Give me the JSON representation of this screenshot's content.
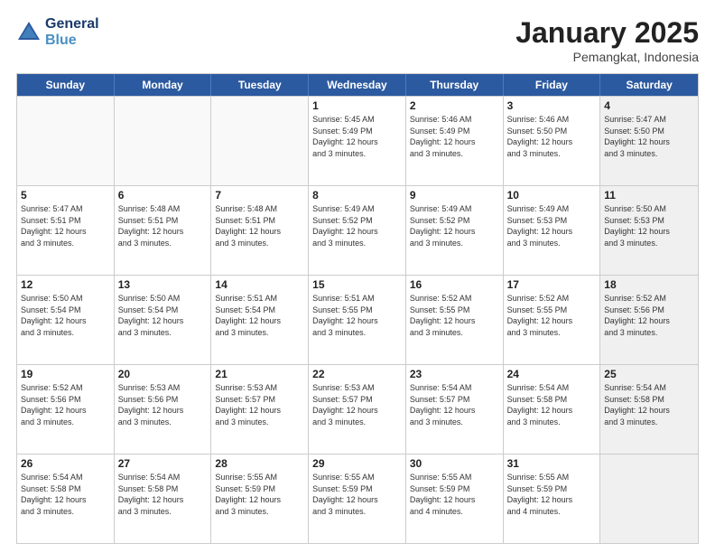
{
  "logo": {
    "line1": "General",
    "line2": "Blue"
  },
  "header": {
    "month": "January 2025",
    "location": "Pemangkat, Indonesia"
  },
  "weekdays": [
    "Sunday",
    "Monday",
    "Tuesday",
    "Wednesday",
    "Thursday",
    "Friday",
    "Saturday"
  ],
  "rows": [
    [
      {
        "day": "",
        "text": "",
        "empty": true
      },
      {
        "day": "",
        "text": "",
        "empty": true
      },
      {
        "day": "",
        "text": "",
        "empty": true
      },
      {
        "day": "1",
        "text": "Sunrise: 5:45 AM\nSunset: 5:49 PM\nDaylight: 12 hours\nand 3 minutes."
      },
      {
        "day": "2",
        "text": "Sunrise: 5:46 AM\nSunset: 5:49 PM\nDaylight: 12 hours\nand 3 minutes."
      },
      {
        "day": "3",
        "text": "Sunrise: 5:46 AM\nSunset: 5:50 PM\nDaylight: 12 hours\nand 3 minutes."
      },
      {
        "day": "4",
        "text": "Sunrise: 5:47 AM\nSunset: 5:50 PM\nDaylight: 12 hours\nand 3 minutes.",
        "shaded": true
      }
    ],
    [
      {
        "day": "5",
        "text": "Sunrise: 5:47 AM\nSunset: 5:51 PM\nDaylight: 12 hours\nand 3 minutes."
      },
      {
        "day": "6",
        "text": "Sunrise: 5:48 AM\nSunset: 5:51 PM\nDaylight: 12 hours\nand 3 minutes."
      },
      {
        "day": "7",
        "text": "Sunrise: 5:48 AM\nSunset: 5:51 PM\nDaylight: 12 hours\nand 3 minutes."
      },
      {
        "day": "8",
        "text": "Sunrise: 5:49 AM\nSunset: 5:52 PM\nDaylight: 12 hours\nand 3 minutes."
      },
      {
        "day": "9",
        "text": "Sunrise: 5:49 AM\nSunset: 5:52 PM\nDaylight: 12 hours\nand 3 minutes."
      },
      {
        "day": "10",
        "text": "Sunrise: 5:49 AM\nSunset: 5:53 PM\nDaylight: 12 hours\nand 3 minutes."
      },
      {
        "day": "11",
        "text": "Sunrise: 5:50 AM\nSunset: 5:53 PM\nDaylight: 12 hours\nand 3 minutes.",
        "shaded": true
      }
    ],
    [
      {
        "day": "12",
        "text": "Sunrise: 5:50 AM\nSunset: 5:54 PM\nDaylight: 12 hours\nand 3 minutes."
      },
      {
        "day": "13",
        "text": "Sunrise: 5:50 AM\nSunset: 5:54 PM\nDaylight: 12 hours\nand 3 minutes."
      },
      {
        "day": "14",
        "text": "Sunrise: 5:51 AM\nSunset: 5:54 PM\nDaylight: 12 hours\nand 3 minutes."
      },
      {
        "day": "15",
        "text": "Sunrise: 5:51 AM\nSunset: 5:55 PM\nDaylight: 12 hours\nand 3 minutes."
      },
      {
        "day": "16",
        "text": "Sunrise: 5:52 AM\nSunset: 5:55 PM\nDaylight: 12 hours\nand 3 minutes."
      },
      {
        "day": "17",
        "text": "Sunrise: 5:52 AM\nSunset: 5:55 PM\nDaylight: 12 hours\nand 3 minutes."
      },
      {
        "day": "18",
        "text": "Sunrise: 5:52 AM\nSunset: 5:56 PM\nDaylight: 12 hours\nand 3 minutes.",
        "shaded": true
      }
    ],
    [
      {
        "day": "19",
        "text": "Sunrise: 5:52 AM\nSunset: 5:56 PM\nDaylight: 12 hours\nand 3 minutes."
      },
      {
        "day": "20",
        "text": "Sunrise: 5:53 AM\nSunset: 5:56 PM\nDaylight: 12 hours\nand 3 minutes."
      },
      {
        "day": "21",
        "text": "Sunrise: 5:53 AM\nSunset: 5:57 PM\nDaylight: 12 hours\nand 3 minutes."
      },
      {
        "day": "22",
        "text": "Sunrise: 5:53 AM\nSunset: 5:57 PM\nDaylight: 12 hours\nand 3 minutes."
      },
      {
        "day": "23",
        "text": "Sunrise: 5:54 AM\nSunset: 5:57 PM\nDaylight: 12 hours\nand 3 minutes."
      },
      {
        "day": "24",
        "text": "Sunrise: 5:54 AM\nSunset: 5:58 PM\nDaylight: 12 hours\nand 3 minutes."
      },
      {
        "day": "25",
        "text": "Sunrise: 5:54 AM\nSunset: 5:58 PM\nDaylight: 12 hours\nand 3 minutes.",
        "shaded": true
      }
    ],
    [
      {
        "day": "26",
        "text": "Sunrise: 5:54 AM\nSunset: 5:58 PM\nDaylight: 12 hours\nand 3 minutes."
      },
      {
        "day": "27",
        "text": "Sunrise: 5:54 AM\nSunset: 5:58 PM\nDaylight: 12 hours\nand 3 minutes."
      },
      {
        "day": "28",
        "text": "Sunrise: 5:55 AM\nSunset: 5:59 PM\nDaylight: 12 hours\nand 3 minutes."
      },
      {
        "day": "29",
        "text": "Sunrise: 5:55 AM\nSunset: 5:59 PM\nDaylight: 12 hours\nand 3 minutes."
      },
      {
        "day": "30",
        "text": "Sunrise: 5:55 AM\nSunset: 5:59 PM\nDaylight: 12 hours\nand 4 minutes."
      },
      {
        "day": "31",
        "text": "Sunrise: 5:55 AM\nSunset: 5:59 PM\nDaylight: 12 hours\nand 4 minutes."
      },
      {
        "day": "",
        "text": "",
        "empty": true,
        "shaded": true
      }
    ]
  ]
}
